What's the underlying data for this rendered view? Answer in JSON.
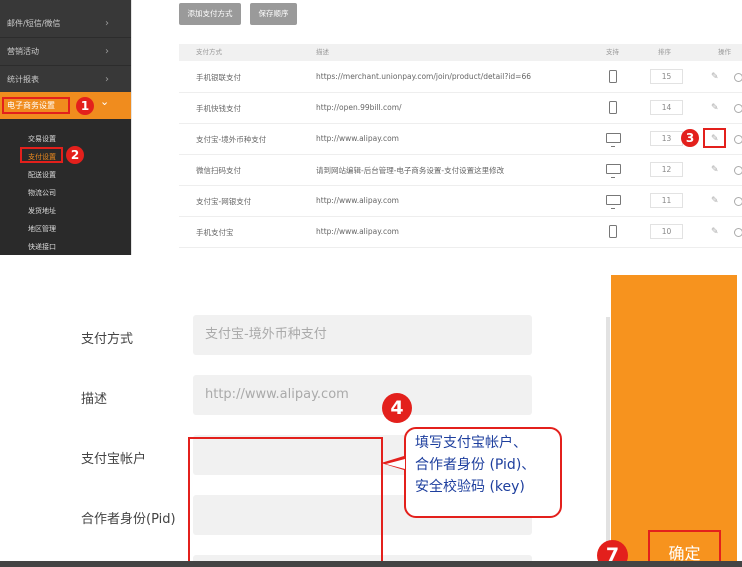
{
  "sidebar": {
    "items": [
      {
        "label": "邮件/短信/微信"
      },
      {
        "label": "营销活动"
      },
      {
        "label": "统计报表"
      }
    ],
    "active": {
      "label": "电子商务设置",
      "badge": "1"
    },
    "sub_items": [
      "交易设置",
      "支付设置",
      "配送设置",
      "物流公司",
      "发货地址",
      "地区管理",
      "快递接口"
    ],
    "selected_badge": "2"
  },
  "toolbar": {
    "add_label": "添加支付方式",
    "save_label": "保存顺序"
  },
  "table": {
    "headers": {
      "method": "支付方式",
      "desc": "描述",
      "support": "支持",
      "order": "排序",
      "action": "操作"
    },
    "rows": [
      {
        "name": "手机银联支付",
        "desc": "https://merchant.unionpay.com/join/product/detail?id=66",
        "device": "phone",
        "order": "15"
      },
      {
        "name": "手机快钱支付",
        "desc": "http://open.99bill.com/",
        "device": "phone",
        "order": "14"
      },
      {
        "name": "支付宝-境外币种支付",
        "desc": "http://www.alipay.com",
        "device": "monitor",
        "order": "13"
      },
      {
        "name": "微信扫码支付",
        "desc": "请到网站编辑-后台管理-电子商务设置-支付设置这里修改",
        "device": "monitor",
        "order": "12"
      },
      {
        "name": "支付宝-网银支付",
        "desc": "http://www.alipay.com",
        "device": "monitor",
        "order": "11"
      },
      {
        "name": "手机支付宝",
        "desc": "http://www.alipay.com",
        "device": "phone",
        "order": "10"
      }
    ],
    "edit_badge": "3"
  },
  "form": {
    "method_label": "支付方式",
    "method_value": "支付宝-境外币种支付",
    "desc_label": "描述",
    "desc_value": "http://www.alipay.com",
    "account_label": "支付宝帐户",
    "pid_label": "合作者身份(Pid)",
    "badge4": "4",
    "callout_lines": [
      "填写支付宝帐户、",
      "合作者身份 (Pid)、",
      "安全校验码 (key)"
    ],
    "badge7": "7",
    "confirm_label": "确定"
  },
  "colors": {
    "accent": "#f08c1e",
    "highlight": "#e3201c",
    "callout_text": "#1e3f9e"
  }
}
